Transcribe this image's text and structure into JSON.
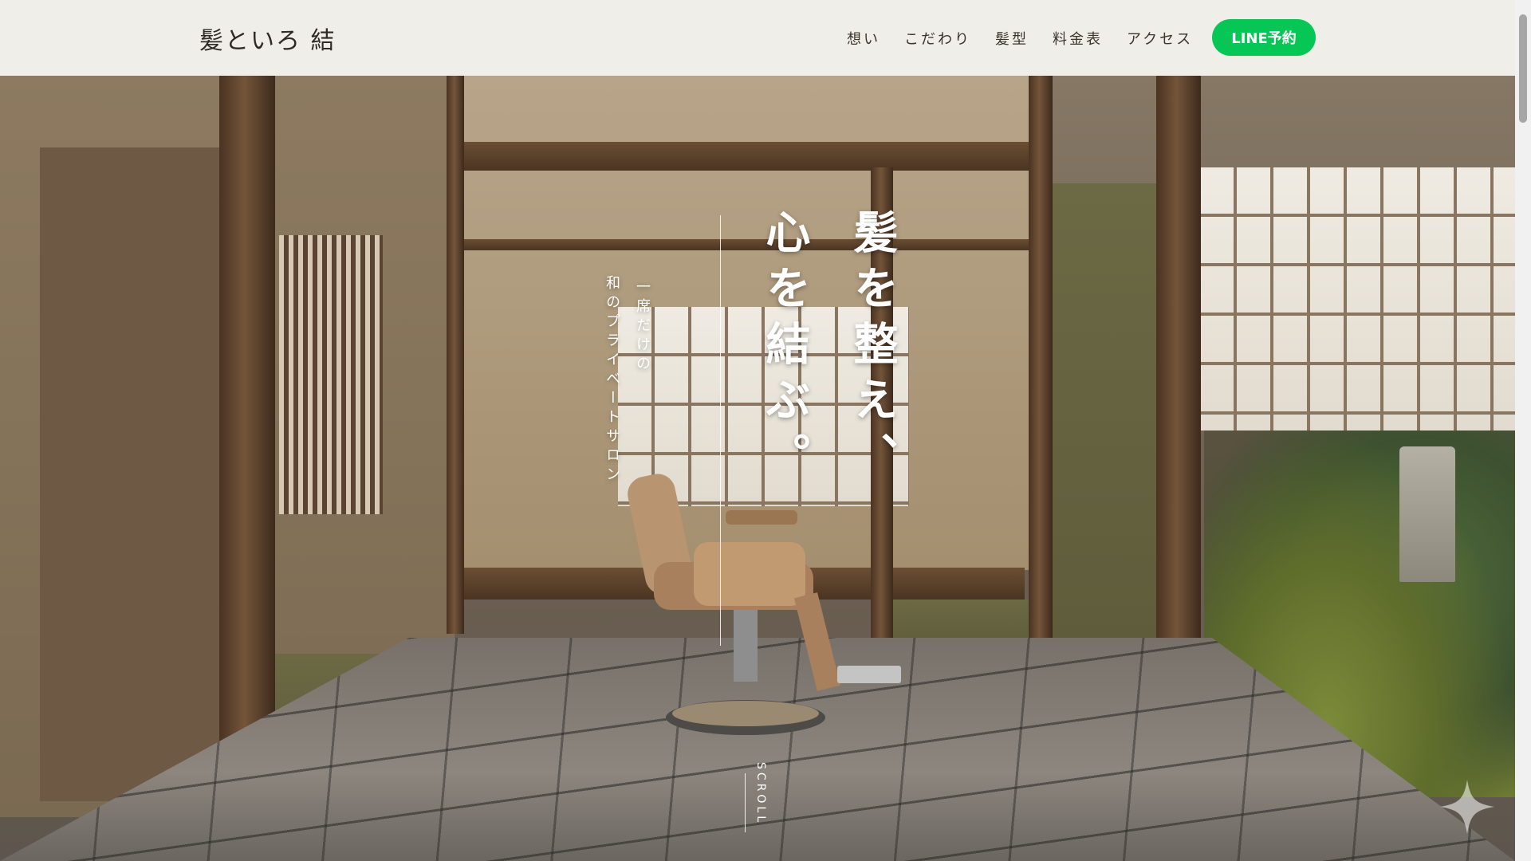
{
  "brand": {
    "name": "髪といろ 結"
  },
  "nav": {
    "items": [
      {
        "label": "想い"
      },
      {
        "label": "こだわり"
      },
      {
        "label": "髪型"
      },
      {
        "label": "料金表"
      },
      {
        "label": "アクセス"
      }
    ],
    "cta_label": "LINE予約"
  },
  "hero": {
    "headline_lines": [
      "髪を整え、",
      "心を結ぶ。"
    ],
    "sub_lines": [
      "一席だけの",
      "和のプライベートサロン"
    ],
    "scroll_label": "SCROLL"
  },
  "colors": {
    "accent": "#06c755",
    "header_bg": "#f4f2ed",
    "text": "#2f2a25"
  },
  "icons": {
    "corner_mark": "sparkle-icon"
  }
}
